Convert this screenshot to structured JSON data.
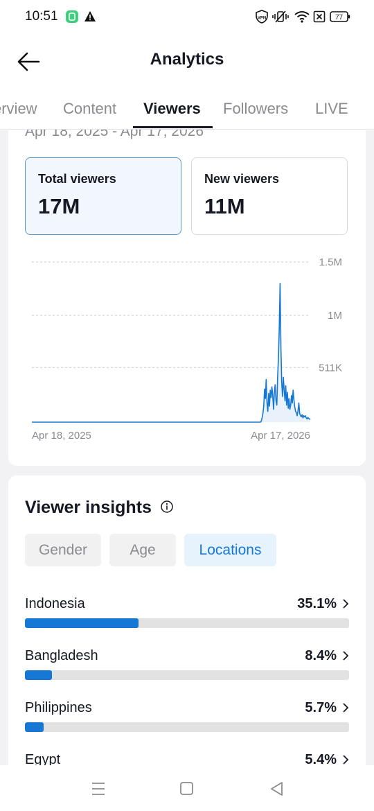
{
  "status_bar": {
    "time": "10:51",
    "battery": "77",
    "vpn_label": "VPN",
    "icons": [
      "app-notification-icon",
      "warning-icon",
      "vpn-icon",
      "vibrate-icon",
      "wifi-icon",
      "sim-icon",
      "battery-icon"
    ]
  },
  "header": {
    "title": "Analytics"
  },
  "tabs": [
    {
      "label": "Overview",
      "visible": "erview"
    },
    {
      "label": "Content",
      "visible": "Content"
    },
    {
      "label": "Viewers",
      "visible": "Viewers",
      "active": true
    },
    {
      "label": "Followers",
      "visible": "Followers"
    },
    {
      "label": "LIVE",
      "visible": "LIVE"
    }
  ],
  "date_range": "Apr 18, 2025 - Apr 17, 2026",
  "metrics": {
    "total": {
      "label": "Total viewers",
      "value": "17M",
      "selected": true
    },
    "new": {
      "label": "New viewers",
      "value": "11M",
      "selected": false
    }
  },
  "chart_data": {
    "type": "line",
    "title": "",
    "x_labels": [
      "Apr 18, 2025",
      "Apr 17, 2026"
    ],
    "y_ticks": [
      "511K",
      "1M",
      "1.5M"
    ],
    "y_tick_values": [
      511000,
      1000000,
      1500000
    ],
    "ylim": [
      0,
      1500000
    ],
    "grid": true,
    "color": "#1678d4",
    "series": [
      {
        "name": "",
        "values": [
          0,
          0,
          0,
          0,
          0,
          0,
          0,
          0,
          0,
          0,
          0,
          0,
          0,
          0,
          0,
          0,
          0,
          0,
          0,
          0,
          0,
          0,
          0,
          0,
          0,
          0,
          0,
          0,
          0,
          0,
          0,
          0,
          0,
          0,
          0,
          0,
          0,
          0,
          0,
          0,
          0,
          0,
          0,
          0,
          0,
          0,
          0,
          0,
          0,
          0,
          0,
          0,
          0,
          0,
          0,
          0,
          0,
          0,
          0,
          0,
          0,
          0,
          0,
          0,
          0,
          0,
          0,
          0,
          0,
          0,
          0,
          0,
          0,
          0,
          0,
          0,
          0,
          0,
          0,
          0,
          0,
          0,
          0,
          0,
          0,
          0,
          0,
          0,
          0,
          0,
          0,
          0,
          0,
          0,
          0,
          0,
          0,
          0,
          0,
          0,
          0,
          0,
          0,
          0,
          0,
          0,
          0,
          0,
          0,
          0,
          0,
          0,
          0,
          0,
          0,
          0,
          0,
          0,
          0,
          0,
          0,
          0,
          0,
          0,
          0,
          0,
          0,
          0,
          0,
          0,
          0,
          0,
          0,
          0,
          0,
          0,
          0,
          0,
          0,
          0,
          0,
          0,
          0,
          0,
          0,
          0,
          0,
          0,
          0,
          0,
          0,
          0,
          0,
          0,
          0,
          0,
          0,
          0,
          0,
          0,
          0,
          0,
          0,
          0,
          0,
          0,
          0,
          0,
          0,
          0,
          0,
          0,
          0,
          0,
          0,
          0,
          0,
          0,
          0,
          0,
          0,
          0,
          0,
          0,
          0,
          0,
          0,
          0,
          0,
          0,
          0,
          0,
          0,
          0,
          0,
          0,
          0,
          0,
          0,
          0,
          0,
          0,
          0,
          0,
          0,
          0,
          0,
          0,
          0,
          0,
          0,
          0,
          0,
          0,
          0,
          0,
          0,
          0,
          0,
          0,
          0,
          0,
          0,
          0,
          0,
          0,
          0,
          0,
          0,
          0,
          0,
          0,
          0,
          0,
          0,
          0,
          0,
          0,
          0,
          0,
          0,
          0,
          0,
          0,
          0,
          0,
          0,
          0,
          0,
          0,
          0,
          0,
          0,
          0,
          0,
          0,
          0,
          0,
          0,
          0,
          0,
          0,
          0,
          0,
          0,
          0,
          0,
          0,
          0,
          0,
          0,
          0,
          0,
          0,
          0,
          0,
          0,
          0,
          0,
          0,
          0,
          10000,
          40000,
          80000,
          150000,
          310000,
          220000,
          400000,
          180000,
          100000,
          270000,
          150000,
          300000,
          230000,
          330000,
          250000,
          120000,
          280000,
          350000,
          200000,
          160000,
          410000,
          600000,
          880000,
          1300000,
          700000,
          380000,
          240000,
          420000,
          300000,
          200000,
          340000,
          160000,
          280000,
          130000,
          220000,
          120000,
          160000,
          250000,
          180000,
          300000,
          210000,
          140000,
          100000,
          90000,
          60000,
          110000,
          180000,
          80000,
          60000,
          50000,
          70000,
          40000,
          60000,
          50000,
          60000,
          40000,
          30000,
          45000,
          35000,
          30000,
          25000
        ]
      }
    ]
  },
  "insights": {
    "title": "Viewer insights",
    "filters": [
      {
        "label": "Gender",
        "active": false
      },
      {
        "label": "Age",
        "active": false
      },
      {
        "label": "Locations",
        "active": true
      }
    ],
    "locations": [
      {
        "name": "Indonesia",
        "pct": "35.1%",
        "value": 35.1
      },
      {
        "name": "Bangladesh",
        "pct": "8.4%",
        "value": 8.4
      },
      {
        "name": "Philippines",
        "pct": "5.7%",
        "value": 5.7
      },
      {
        "name": "Egypt",
        "pct": "5.4%",
        "value": 5.4
      }
    ]
  },
  "nav_bar": {
    "icons": [
      "recent-apps-icon",
      "home-icon",
      "back-icon"
    ]
  }
}
